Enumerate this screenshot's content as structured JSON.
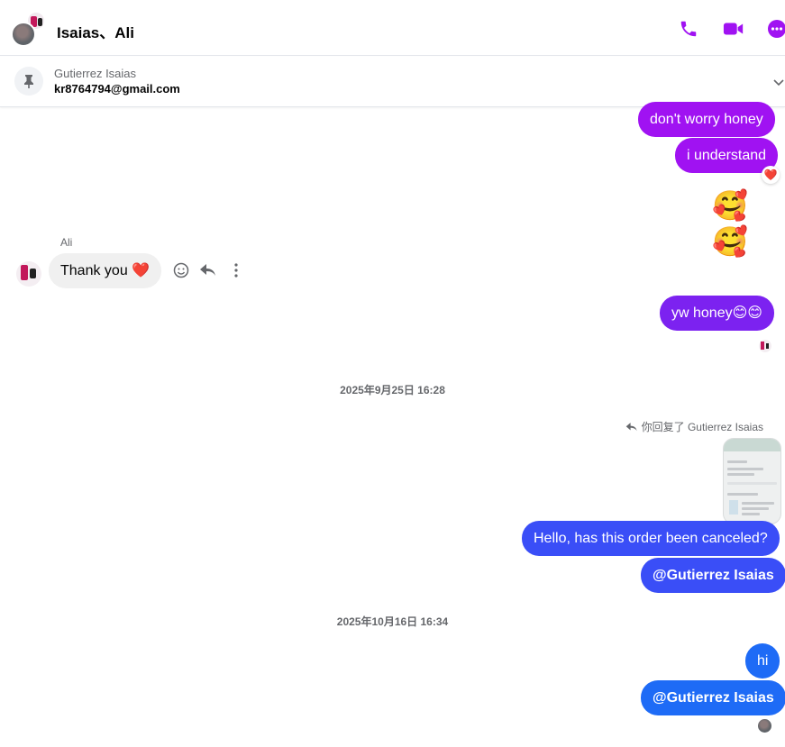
{
  "header": {
    "title": "Isaias、Ali",
    "accent_color": "#a012f2",
    "actions": [
      "phone-icon",
      "video-icon",
      "more-icon"
    ]
  },
  "pinned": {
    "name": "Gutierrez Isaias",
    "email": "kr8764794@gmail.com"
  },
  "messages": {
    "m1": "don't worry honey",
    "m2": "i understand",
    "m2_reaction": "❤️",
    "m3_emoji": "🥰🥰",
    "ali_sender": "Ali",
    "ali_text": "Thank you ❤️",
    "m4": "yw honey😊😊",
    "timestamp1": "2025年9月25日 16:28",
    "reply_note": "你回复了 Gutierrez Isaias",
    "m5": "Hello, has this order been canceled?",
    "m6": "@Gutierrez Isaias",
    "timestamp2": "2025年10月16日 16:34",
    "m7": "hi",
    "m8": "@Gutierrez Isaias"
  }
}
